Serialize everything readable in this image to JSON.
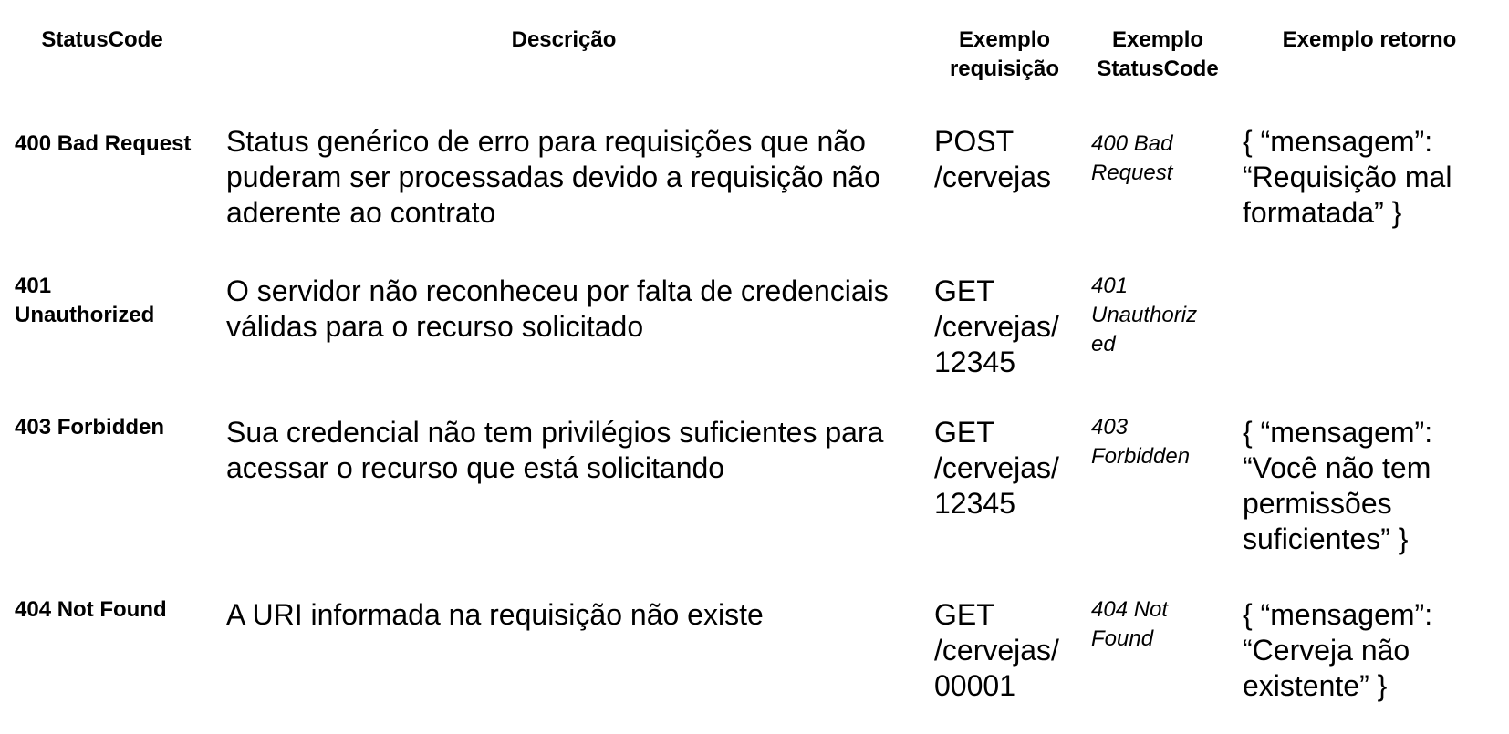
{
  "headers": {
    "status_code": "StatusCode",
    "description": "Descrição",
    "example_request": "Exemplo requisição",
    "example_status_code": "Exemplo StatusCode",
    "example_return": "Exemplo retorno"
  },
  "rows": [
    {
      "code": "400 Bad Request",
      "description": "Status genérico de erro para requisições que não puderam ser processadas devido a requisição não aderente ao contrato",
      "request": "POST /cervejas",
      "status_code_example": "400 Bad Request",
      "return": "{ “mensagem”: “Requisição mal formatada” }"
    },
    {
      "code": "401 Unauthorized",
      "description": "O servidor não reconheceu por falta de credenciais válidas para o recurso solicitado",
      "request": "GET /cervejas/ 12345",
      "status_code_example": "401 Unauthoriz ed",
      "return": ""
    },
    {
      "code": "403 Forbidden",
      "description": "Sua credencial não tem privilégios suficientes para acessar o recurso que está solicitando",
      "request": "GET /cervejas/ 12345",
      "status_code_example": "403 Forbidden",
      "return": "{ “mensagem”: “Você não tem permissões suficientes” }"
    },
    {
      "code": "404 Not Found",
      "description": "A URI informada na requisição não existe",
      "request": "GET /cervejas/ 00001",
      "status_code_example": "404 Not Found",
      "return": "{ “mensagem”: “Cerveja não existente” }"
    }
  ]
}
